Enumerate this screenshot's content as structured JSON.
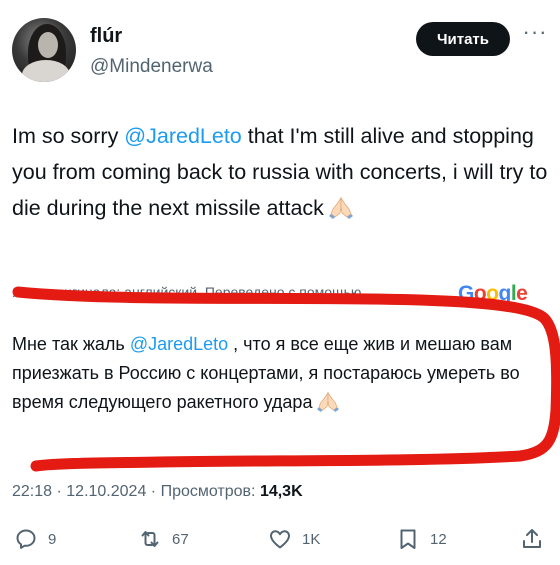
{
  "author": {
    "display_name": "flúr",
    "handle": "@Mindenerwa"
  },
  "follow_button": "Читать",
  "tweet": {
    "text_before": "Im so sorry ",
    "mention": "@JaredLeto",
    "text_after": "  that I'm still alive and stopping you from coming back to russia with concerts, i will try to die during the next missile attack"
  },
  "translation": {
    "label": "Язык оригинала: английский. Переведено с помощью",
    "provider": "Google",
    "text_before": "Мне так жаль ",
    "mention": "@JaredLeto",
    "text_after": " , что я все еще жив и мешаю вам приезжать в Россию с концертами, я постараюсь умереть во время следующего ракетного удара"
  },
  "meta": {
    "time": "22:18",
    "date": "12.10.2024",
    "views_label": "Просмотров:",
    "views_count": "14,3K"
  },
  "actions": {
    "replies": "9",
    "reposts": "67",
    "likes": "1K",
    "bookmarks": "12"
  },
  "colors": {
    "accent": "#1d9bf0",
    "text": "#0f1419",
    "secondary": "#536471",
    "annotation_red": "#e31b12"
  },
  "icons": [
    "more-icon",
    "praying-hands-emoji",
    "reply-icon",
    "repost-icon",
    "like-icon",
    "bookmark-icon",
    "share-icon"
  ]
}
